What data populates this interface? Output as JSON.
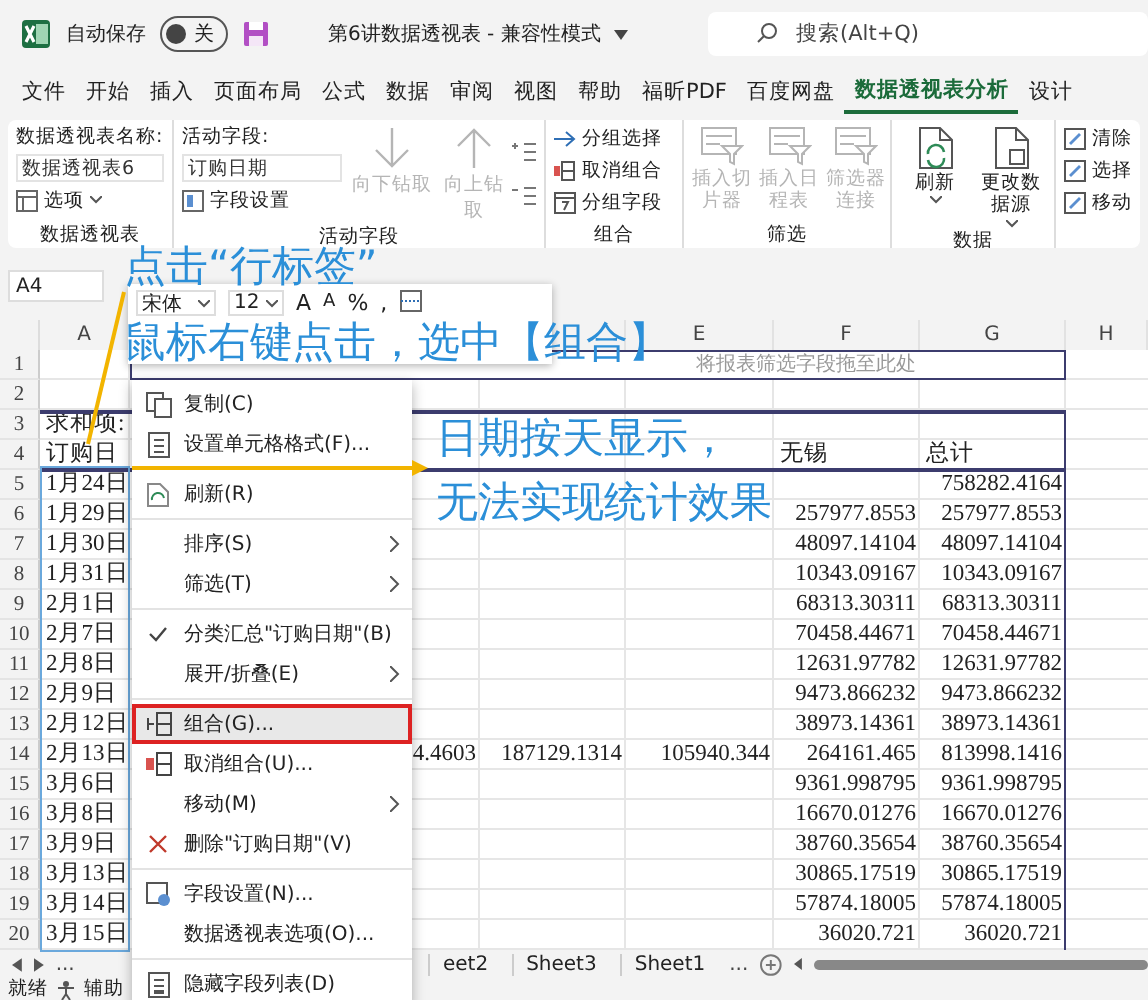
{
  "title_bar": {
    "autosave_label": "自动保存",
    "autosave": {
      "on": false,
      "label": "关"
    },
    "title": "第6讲数据透视表 - 兼容性模式",
    "search": {
      "placeholder": "搜索(Alt+Q)"
    }
  },
  "menu_tabs": [
    {
      "label": "文件",
      "selected": false
    },
    {
      "label": "开始",
      "selected": false
    },
    {
      "label": "插入",
      "selected": false
    },
    {
      "label": "页面布局",
      "selected": false
    },
    {
      "label": "公式",
      "selected": false
    },
    {
      "label": "数据",
      "selected": false
    },
    {
      "label": "审阅",
      "selected": false
    },
    {
      "label": "视图",
      "selected": false
    },
    {
      "label": "帮助",
      "selected": false
    },
    {
      "label": "福昕PDF",
      "selected": false
    },
    {
      "label": "百度网盘",
      "selected": false
    },
    {
      "label": "数据透视表分析",
      "selected": true
    },
    {
      "label": "设计",
      "selected": false
    }
  ],
  "ribbon": {
    "pivot_table": {
      "name_label": "数据透视表名称:",
      "name_value": "数据透视表6",
      "options_button": "选项",
      "group_label": "数据透视表"
    },
    "active_field": {
      "field_label": "活动字段:",
      "field_value": "订购日期",
      "settings_button": "字段设置",
      "drill_buttons": [
        {
          "label": "向下钻取",
          "disabled": true
        },
        {
          "label": "向上钻取",
          "disabled": true
        }
      ],
      "group_label": "活动字段"
    },
    "group": {
      "buttons": [
        {
          "label": "分组选择"
        },
        {
          "label": "取消组合"
        },
        {
          "label": "分组字段"
        }
      ],
      "group_label": "组合"
    },
    "filter": {
      "buttons": [
        {
          "label": "插入切片器",
          "disabled": true
        },
        {
          "label": "插入日程表",
          "disabled": true
        },
        {
          "label": "筛选器连接",
          "disabled": true
        }
      ],
      "group_label": "筛选"
    },
    "data": {
      "buttons": [
        {
          "label": "刷新"
        },
        {
          "label": "更改数据源"
        }
      ],
      "group_label": "数据"
    },
    "actions": {
      "buttons": [
        {
          "label": "清除"
        },
        {
          "label": "选择"
        },
        {
          "label": "移动"
        }
      ]
    }
  },
  "name_box": "A4",
  "mini_toolbar": {
    "font": "宋体",
    "size": "12",
    "buttons": [
      "A",
      "A",
      "%",
      ","
    ]
  },
  "column_headers": {
    "A": "A",
    "E": "E",
    "F": "F",
    "G": "G",
    "H": "H"
  },
  "rows": [
    {
      "row": "1",
      "hint": "将报表筛选字段拖至此处"
    },
    {
      "row": "2"
    },
    {
      "row": "3",
      "A": "求和项:"
    },
    {
      "row": "4",
      "A": "订购日",
      "F": "无锡",
      "G": "总计"
    },
    {
      "row": "5",
      "A": "1月24日",
      "G": "758282.4164"
    },
    {
      "row": "6",
      "A": "1月29日",
      "F": "257977.8553",
      "G": "257977.8553"
    },
    {
      "row": "7",
      "A": "1月30日",
      "F": "48097.14104",
      "G": "48097.14104"
    },
    {
      "row": "8",
      "A": "1月31日",
      "F": "10343.09167",
      "G": "10343.09167"
    },
    {
      "row": "9",
      "A": "2月1日",
      "F": "68313.30311",
      "G": "68313.30311"
    },
    {
      "row": "10",
      "A": "2月7日",
      "F": "70458.44671",
      "G": "70458.44671"
    },
    {
      "row": "11",
      "A": "2月8日",
      "F": "12631.97782",
      "G": "12631.97782"
    },
    {
      "row": "12",
      "A": "2月9日",
      "F": "9473.866232",
      "G": "9473.866232"
    },
    {
      "row": "13",
      "A": "2月12日",
      "F": "38973.14361",
      "G": "38973.14361"
    },
    {
      "row": "14",
      "A": "2月13日",
      "C": "4.4603",
      "D": "187129.1314",
      "E": "105940.344",
      "F": "264161.465",
      "G": "813998.1416"
    },
    {
      "row": "15",
      "A": "3月6日",
      "F": "9361.998795",
      "G": "9361.998795"
    },
    {
      "row": "16",
      "A": "3月8日",
      "F": "16670.01276",
      "G": "16670.01276"
    },
    {
      "row": "17",
      "A": "3月9日",
      "F": "38760.35654",
      "G": "38760.35654"
    },
    {
      "row": "18",
      "A": "3月13日",
      "F": "30865.17519",
      "G": "30865.17519"
    },
    {
      "row": "19",
      "A": "3月14日",
      "F": "57874.18005",
      "G": "57874.18005"
    },
    {
      "row": "20",
      "A": "3月15日",
      "F": "36020.721",
      "G": "36020.721"
    }
  ],
  "context_menu": {
    "groups": [
      [
        {
          "label": "复制(C)",
          "checked": false,
          "submenu": false,
          "selected": false
        },
        {
          "label": "设置单元格格式(F)...",
          "checked": false,
          "submenu": false,
          "selected": false
        }
      ],
      [
        {
          "label": "刷新(R)",
          "checked": false,
          "submenu": false,
          "selected": false
        }
      ],
      [
        {
          "label": "排序(S)",
          "checked": false,
          "submenu": true,
          "selected": false
        },
        {
          "label": "筛选(T)",
          "checked": false,
          "submenu": true,
          "selected": false
        }
      ],
      [
        {
          "label": "分类汇总\"订购日期\"(B)",
          "checked": true,
          "submenu": false,
          "selected": false
        },
        {
          "label": "展开/折叠(E)",
          "checked": false,
          "submenu": true,
          "selected": false
        }
      ],
      [
        {
          "label": "组合(G)...",
          "checked": false,
          "submenu": false,
          "selected": true
        },
        {
          "label": "取消组合(U)...",
          "checked": false,
          "submenu": false,
          "selected": false
        },
        {
          "label": "移动(M)",
          "checked": false,
          "submenu": true,
          "selected": false
        },
        {
          "label": "删除\"订购日期\"(V)",
          "checked": false,
          "submenu": false,
          "selected": false
        }
      ],
      [
        {
          "label": "字段设置(N)...",
          "checked": false,
          "submenu": false,
          "selected": false
        },
        {
          "label": "数据透视表选项(O)...",
          "checked": false,
          "submenu": false,
          "selected": false
        }
      ],
      [
        {
          "label": "隐藏字段列表(D)",
          "checked": false,
          "submenu": false,
          "selected": false
        }
      ]
    ]
  },
  "sheet_tabs": {
    "more_left": "...",
    "tabs": [
      {
        "label": "eet2"
      },
      {
        "label": "Sheet3"
      },
      {
        "label": "Sheet1"
      }
    ],
    "more_right": "..."
  },
  "status_bar": {
    "ready": "就绪",
    "accessibility": "辅助"
  },
  "annotations": [
    {
      "text": "点击“行标签”"
    },
    {
      "text": "鼠标右键点击，选中【组合】"
    },
    {
      "text": "日期按天显示，"
    },
    {
      "text": "无法实现统计效果"
    }
  ]
}
